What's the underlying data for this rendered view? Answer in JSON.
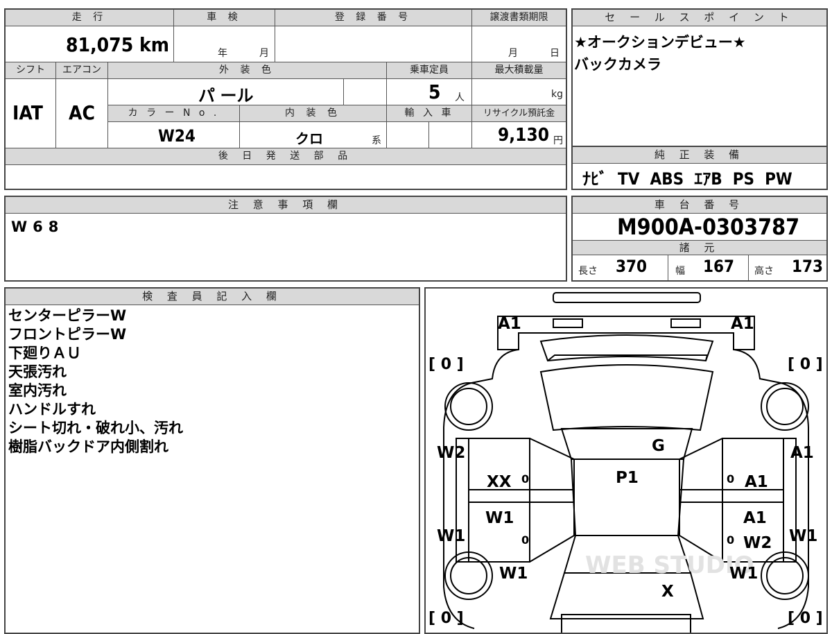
{
  "top_left": {
    "headers": {
      "mileage": "走 行",
      "inspection": "車 検",
      "registration": "登 録 番 号",
      "transfer_deadline": "譲渡書類期限",
      "shift": "シフト",
      "aircon": "エアコン",
      "exterior_color": "外 装 色",
      "capacity": "乗車定員",
      "max_load": "最大積載量",
      "color_no": "カ ラ ー N o .",
      "interior_color": "内 装 色",
      "import": "輸 入 車",
      "recycle_fee": "リサイクル預託金",
      "later_parts": "後 日 発 送 部 品"
    },
    "mileage": "81,075 km",
    "inspection_year_unit": "年",
    "inspection_month_unit": "月",
    "transfer_month_unit": "月",
    "transfer_day_unit": "日",
    "shift": "IAT",
    "aircon": "AC",
    "exterior_color": "パ ール",
    "capacity": "5",
    "capacity_unit": "人",
    "max_load_unit": "kg",
    "color_no": "W24",
    "interior_color": "クロ",
    "interior_suffix": "系",
    "recycle_fee": "9,130",
    "recycle_unit": "円"
  },
  "sales_point": {
    "header": "セ ー ル ス ポ イ ン ト",
    "line1": "★オークションデビュー★",
    "line2": "バックカメラ"
  },
  "genuine_equipment": {
    "header": "純 正 装 備",
    "items": "ﾅﾋﾞ  TV  ABS  ｴｱB  PS  PW"
  },
  "notes_field": {
    "header": "注 意 事 項 欄",
    "text": "W68"
  },
  "chassis": {
    "header": "車 台 番 号",
    "number": "M900A-0303787",
    "specs_header": "諸 元",
    "length_label": "長さ",
    "length": "370",
    "width_label": "幅",
    "width": "167",
    "height_label": "高さ",
    "height": "173"
  },
  "inspector": {
    "header": "検 査 員 記 入 欄",
    "lines": [
      "センターピラーW",
      "フロントピラーW",
      "下廻りＡＵ",
      "天張汚れ",
      "室内汚れ",
      "ハンドルすれ",
      "シート切れ・破れ小、汚れ",
      "樹脂バックドア内側割れ"
    ]
  },
  "diagram": {
    "tire_left_top": "[ 0 ]",
    "tire_right_top": "[ 0 ]",
    "tire_left_bottom": "[ 0 ]",
    "tire_right_bottom": "[ 0 ]",
    "marks": {
      "rear_left": "A1",
      "rear_right": "A1",
      "roof": "G",
      "left_quarter": "W2",
      "right_quarter": "A1",
      "rear_door_left": "XX",
      "rear_door_right": "A1",
      "roof_center": "P1",
      "front_door_left": "W1",
      "front_door_right_1": "A1",
      "front_door_right_2": "W2",
      "left_side": "W1",
      "right_side": "W1",
      "front_fender_left": "W1",
      "front_fender_right": "W1",
      "hood": "X",
      "zero_1": "0",
      "zero_2": "0",
      "zero_3": "0",
      "zero_4": "0"
    }
  },
  "watermark": "WEB STUDIO"
}
